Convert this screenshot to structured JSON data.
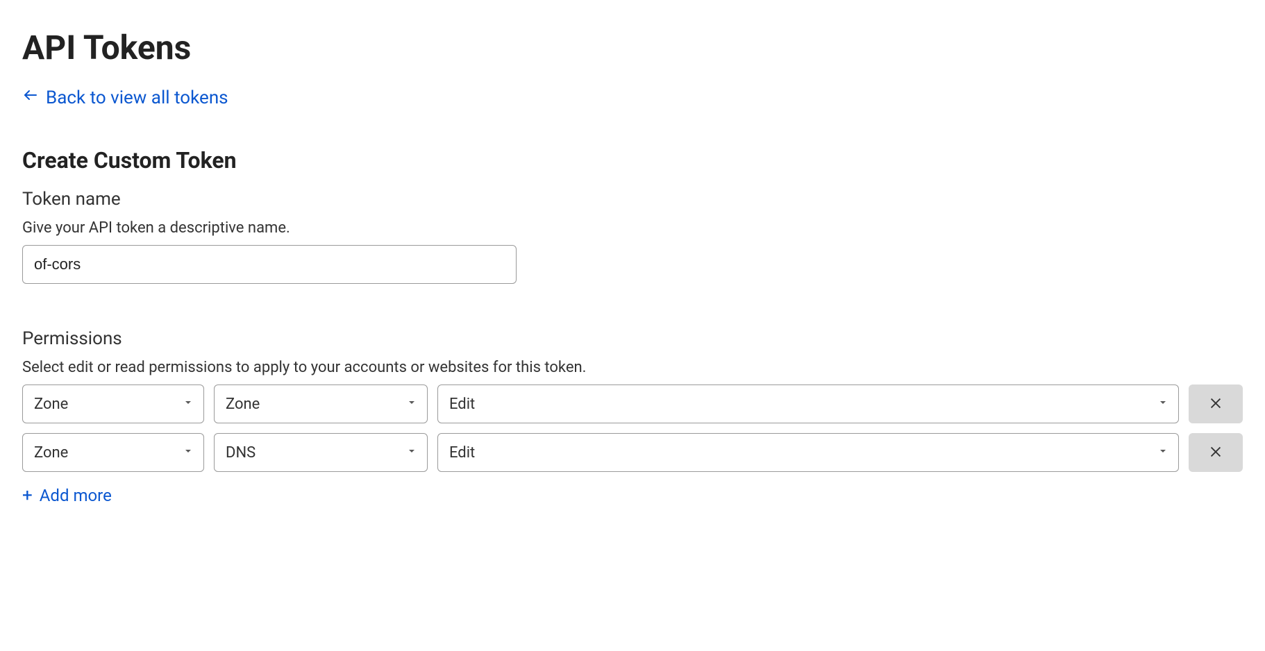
{
  "header": {
    "title": "API Tokens",
    "back_label": "Back to view all tokens"
  },
  "form": {
    "section_title": "Create Custom Token",
    "token_name": {
      "label": "Token name",
      "help": "Give your API token a descriptive name.",
      "value": "of-cors"
    },
    "permissions": {
      "label": "Permissions",
      "help": "Select edit or read permissions to apply to your accounts or websites for this token.",
      "rows": [
        {
          "scope": "Zone",
          "item": "Zone",
          "level": "Edit"
        },
        {
          "scope": "Zone",
          "item": "DNS",
          "level": "Edit"
        }
      ],
      "add_more_label": "Add more"
    }
  }
}
